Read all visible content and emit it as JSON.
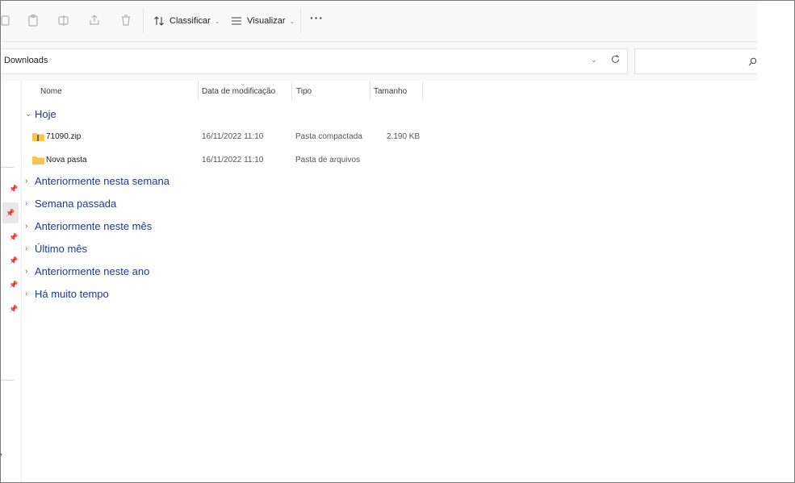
{
  "toolbar": {
    "icons": [
      "copy-icon",
      "paste-icon",
      "rename-icon",
      "share-icon",
      "delete-icon"
    ],
    "sort_label": "Classificar",
    "view_label": "Visualizar",
    "more_label": "···"
  },
  "address": {
    "path": "Downloads",
    "dropdown_glyph": "⌄"
  },
  "search": {
    "placeholder": ""
  },
  "columns": {
    "name": "Nome",
    "date": "Data de modificação",
    "type": "Tipo",
    "size": "Tamanho"
  },
  "groups": {
    "today": {
      "label": "Hoje",
      "files": [
        {
          "name": "71090.zip",
          "date": "16/11/2022 11:10",
          "type": "Pasta compactada",
          "size": "2.190 KB",
          "icon": "zip-folder-icon"
        },
        {
          "name": "Nova pasta",
          "date": "16/11/2022 11:10",
          "type": "Pasta de arquivos",
          "size": "",
          "icon": "folder-icon"
        }
      ]
    },
    "collapsed": [
      "Anteriormente nesta semana",
      "Semana passada",
      "Anteriormente neste mês",
      "Último mês",
      "Anteriormente neste ano",
      "Há muito tempo"
    ]
  },
  "colors": {
    "group_text": "#1f3a8a",
    "folder": "#f5c451"
  }
}
